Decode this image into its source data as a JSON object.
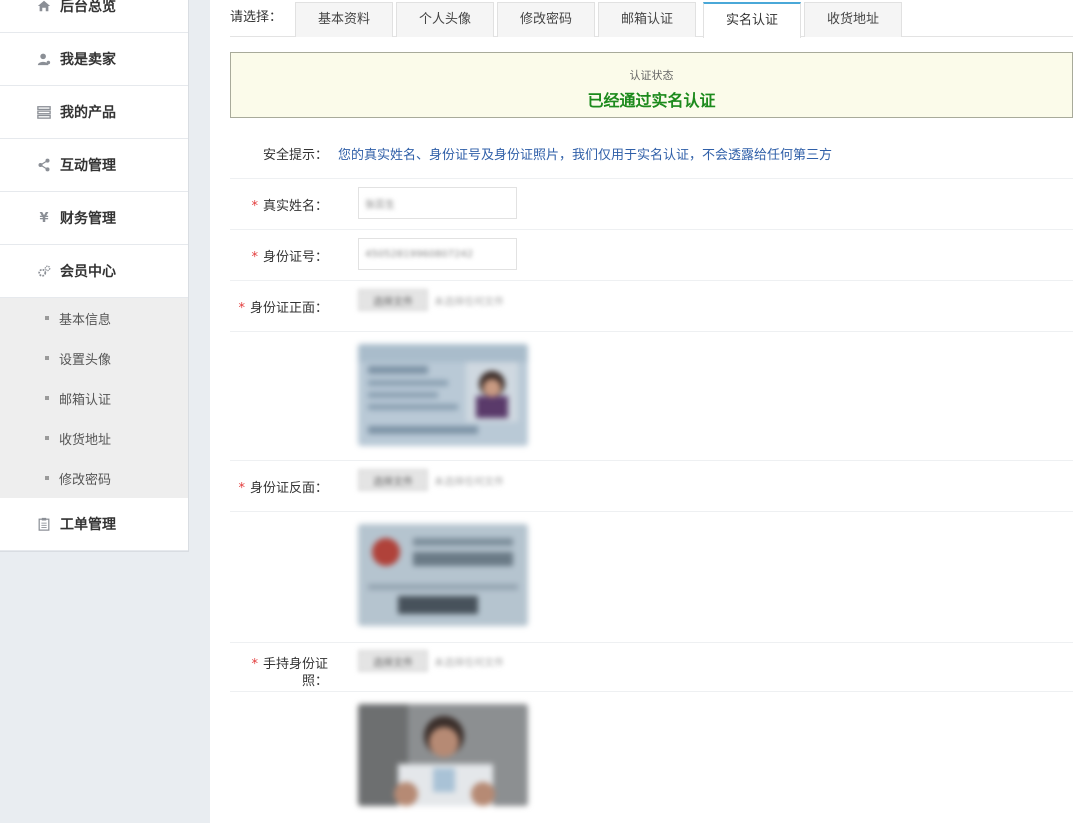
{
  "sidebar": {
    "items": [
      {
        "label": "后台总览",
        "icon": "home-icon"
      },
      {
        "label": "我是卖家",
        "icon": "user-icon"
      },
      {
        "label": "我的产品",
        "icon": "list-icon"
      },
      {
        "label": "互动管理",
        "icon": "share-icon"
      },
      {
        "label": "财务管理",
        "icon": "yen-icon"
      },
      {
        "label": "会员中心",
        "icon": "gears-icon"
      },
      {
        "label": "工单管理",
        "icon": "clipboard-icon"
      }
    ],
    "subitems": [
      "基本信息",
      "设置头像",
      "邮箱认证",
      "收货地址",
      "修改密码"
    ]
  },
  "tabs": {
    "prompt": "请选择：",
    "items": [
      "基本资料",
      "个人头像",
      "修改密码",
      "邮箱认证",
      "实名认证",
      "收货地址"
    ],
    "active": "实名认证"
  },
  "status": {
    "label": "认证状态",
    "value": "已经通过实名认证",
    "color": "#1c8a1c"
  },
  "form": {
    "tip_label": "安全提示：",
    "tip_text": "您的真实姓名、身份证号及身份证照片，我们仅用于实名认证，不会透露给任何第三方",
    "required_mark": "*",
    "name_label": "真实姓名：",
    "name_value": "张蕊生",
    "id_label": "身份证号：",
    "id_value": "45052819960807242",
    "front_label": "身份证正面：",
    "back_label": "身份证反面：",
    "hold_label": "手持身份证照：",
    "upload_button": "选择文件",
    "upload_note": "未选择任何文件"
  },
  "colors": {
    "accent": "#4aa8d8",
    "required": "#e23b3b",
    "tip": "#2f5fa8",
    "status_bg": "#fbfbea"
  }
}
